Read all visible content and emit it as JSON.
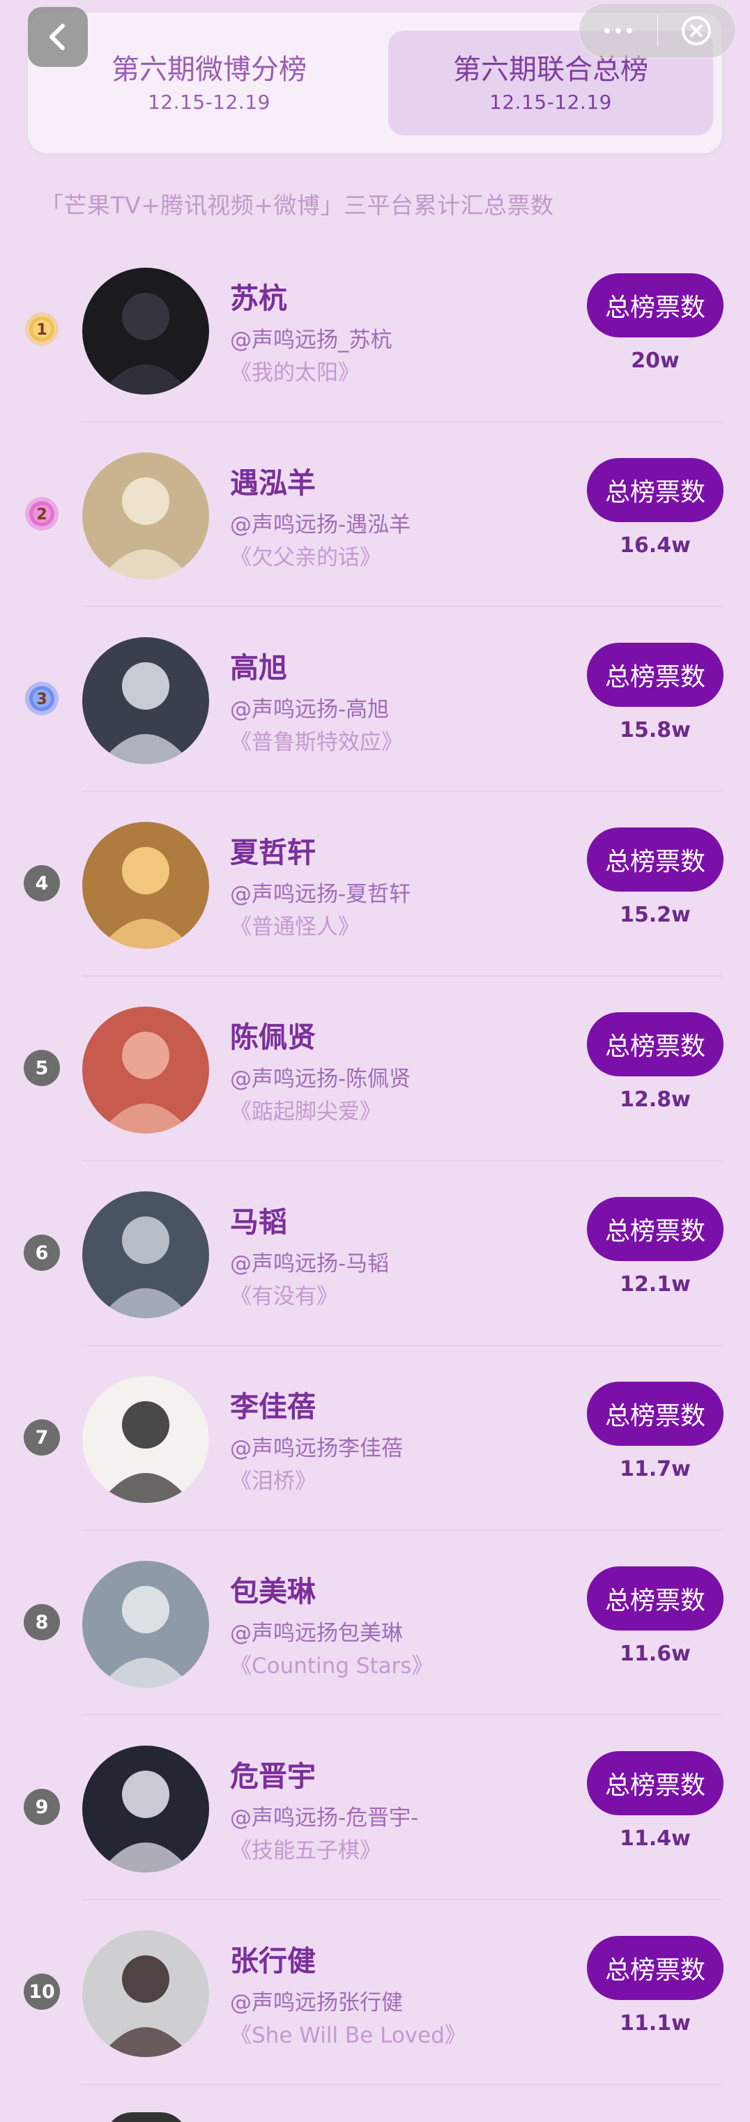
{
  "header": {
    "tabs": [
      {
        "title": "第六期微博分榜",
        "date": "12.15-12.19",
        "active": false
      },
      {
        "title": "第六期联合总榜",
        "date": "12.15-12.19",
        "active": true
      }
    ],
    "back_icon": "chevron-left-icon",
    "capsule": {
      "more_icon": "ellipsis-icon",
      "close_icon": "close-circle-icon"
    }
  },
  "subtitle": "「芒果TV+腾讯视频+微博」三平台累计汇总票数",
  "vote_button_label": "总榜票数",
  "colors": {
    "background": "#efdcf3",
    "accent": "#7b10a8",
    "name": "#7a2f99",
    "gold": "#f2c14e",
    "pink": "#e46fd0",
    "blue": "#6f8ef0"
  },
  "entries": [
    {
      "rank": "1",
      "name": "苏杭",
      "handle": "@声鸣远扬_苏杭",
      "song": "《我的太阳》",
      "votes": "20w",
      "medal": "gold"
    },
    {
      "rank": "2",
      "name": "遇泓羊",
      "handle": "@声鸣远扬-遇泓羊",
      "song": "《欠父亲的话》",
      "votes": "16.4w",
      "medal": "pink"
    },
    {
      "rank": "3",
      "name": "高旭",
      "handle": "@声鸣远扬-高旭",
      "song": "《普鲁斯特效应》",
      "votes": "15.8w",
      "medal": "blue"
    },
    {
      "rank": "4",
      "name": "夏哲轩",
      "handle": "@声鸣远扬-夏哲轩",
      "song": "《普通怪人》",
      "votes": "15.2w",
      "medal": ""
    },
    {
      "rank": "5",
      "name": "陈佩贤",
      "handle": "@声鸣远扬-陈佩贤",
      "song": "《踮起脚尖爱》",
      "votes": "12.8w",
      "medal": ""
    },
    {
      "rank": "6",
      "name": "马韬",
      "handle": "@声鸣远扬-马韬",
      "song": "《有没有》",
      "votes": "12.1w",
      "medal": ""
    },
    {
      "rank": "7",
      "name": "李佳蓓",
      "handle": "@声鸣远扬李佳蓓",
      "song": "《泪桥》",
      "votes": "11.7w",
      "medal": ""
    },
    {
      "rank": "8",
      "name": "包美琳",
      "handle": "@声鸣远扬包美琳",
      "song": "《Counting Stars》",
      "votes": "11.6w",
      "medal": ""
    },
    {
      "rank": "9",
      "name": "危晋宇",
      "handle": "@声鸣远扬-危晋宇-",
      "song": "《技能五子棋》",
      "votes": "11.4w",
      "medal": ""
    },
    {
      "rank": "10",
      "name": "张行健",
      "handle": "@声鸣远扬张行健",
      "song": "《She Will Be Loved》",
      "votes": "11.1w",
      "medal": ""
    }
  ]
}
